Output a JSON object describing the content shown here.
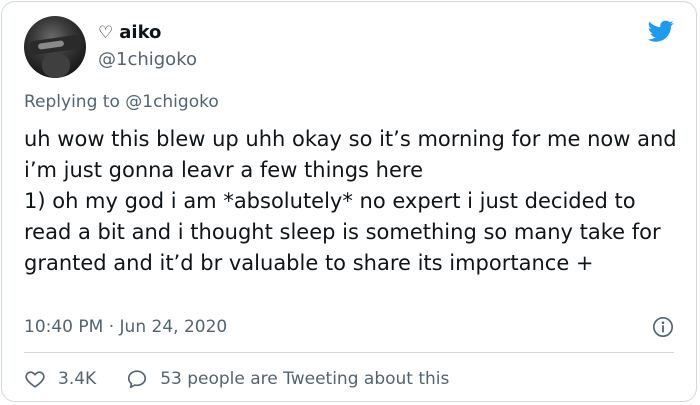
{
  "tweet": {
    "display_name": "aiko",
    "name_emoji": "♡",
    "handle": "@1chigoko",
    "replying_prefix": "Replying to",
    "replying_to": "@1chigoko",
    "text": "uh wow this blew up uhh okay so it’s morning for me now and i’m just gonna leavr a few things here\n1) oh my god i am *absolutely* no expert i just decided to read a bit and i thought sleep is something so many take for granted and it’d br valuable to share its importance +",
    "time": "10:40 PM",
    "separator": "·",
    "date": "Jun 24, 2020",
    "likes": "3.4K",
    "replies_text": "53 people are Tweeting about this"
  },
  "colors": {
    "twitter_blue": "#1d9bf0",
    "secondary_text": "#536471",
    "border": "#cfd9de"
  },
  "icons": {
    "brand": "twitter-bird-icon",
    "info": "info-icon",
    "like": "heart-icon",
    "reply": "speech-bubble-icon"
  }
}
